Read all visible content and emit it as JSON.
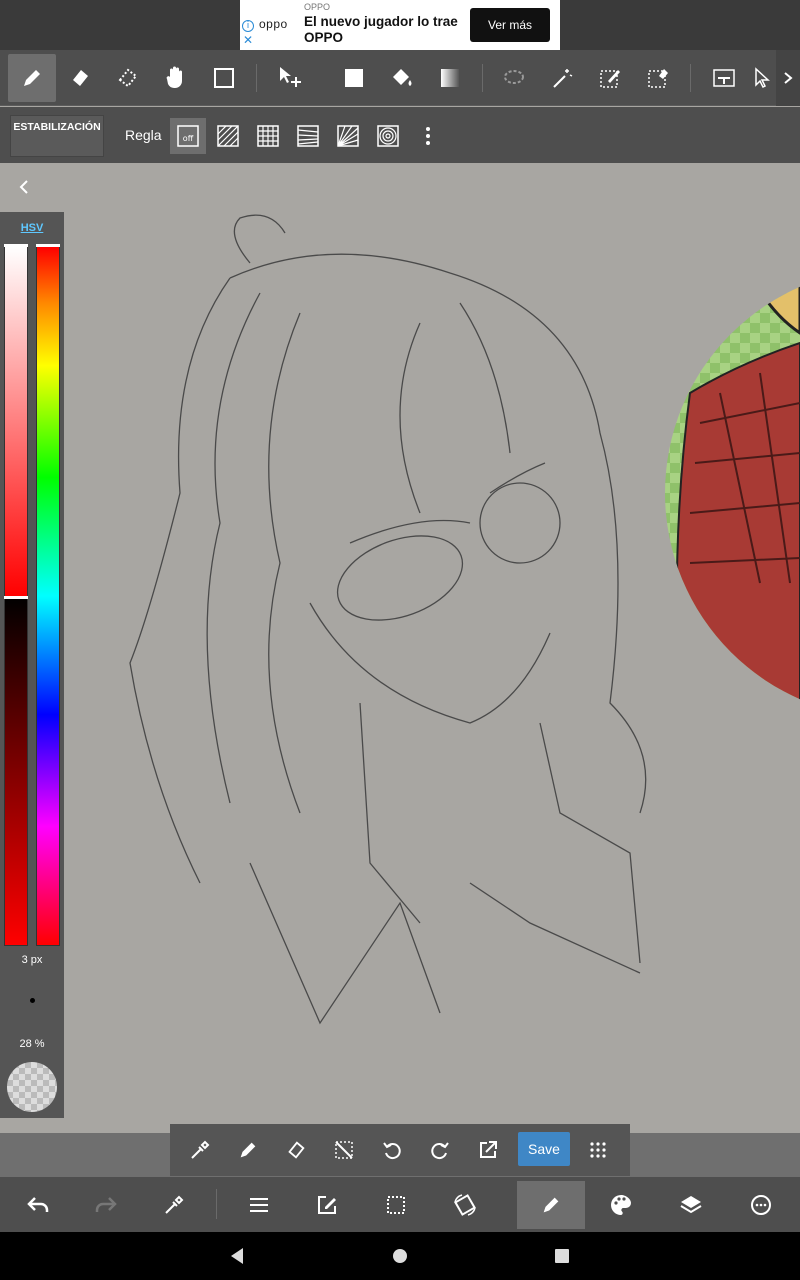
{
  "ad": {
    "advertiser": "OPPO",
    "brand": "oppo",
    "headline": "El nuevo jugador lo trae OPPO",
    "cta_label": "Ver más"
  },
  "toolbar": {
    "tools": [
      "pen-icon",
      "eraser-icon",
      "blur-icon",
      "hand-icon",
      "shape-icon",
      "move-icon",
      "fill-icon",
      "bucket-icon",
      "gradient-icon",
      "lasso-icon",
      "magic-wand-icon",
      "select-pen-icon",
      "select-eraser-icon",
      "text-icon",
      "cursor-icon"
    ],
    "active_tool": "pen-icon"
  },
  "subbar": {
    "stabilization_label": "ESTABILIZACIÓN",
    "ruler_label": "Regla",
    "ruler_off_label": "off"
  },
  "color_panel": {
    "mode_label": "HSV",
    "brush_size": "3 px",
    "opacity": "28 %",
    "current_color": "#ff0000"
  },
  "quickbar": {
    "save_label": "Save"
  },
  "colors": {
    "toolbar_bg": "#4e4e4e",
    "canvas_bg": "#a8a6a2",
    "accent": "#3f87c6"
  }
}
